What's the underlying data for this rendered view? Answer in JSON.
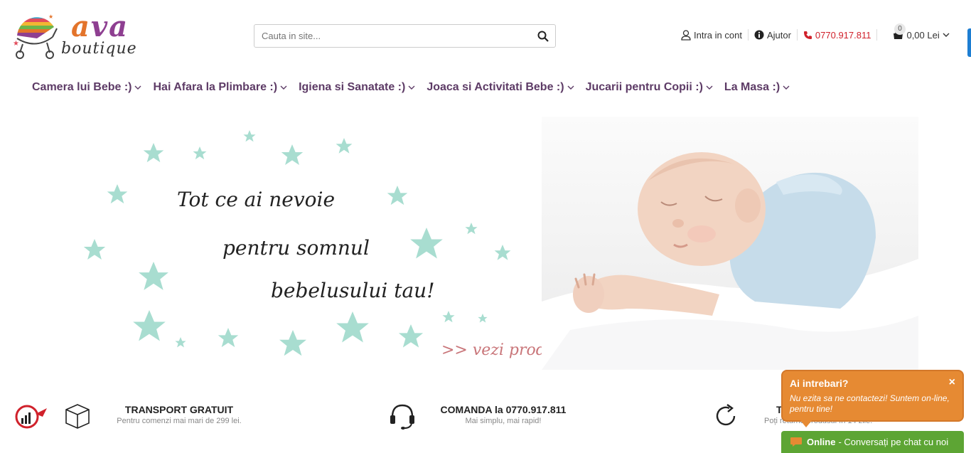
{
  "logo": {
    "ava_a1": "a",
    "ava_v": "v",
    "ava_a2": "a",
    "boutique": "boutique"
  },
  "search": {
    "placeholder": "Cauta in site..."
  },
  "toplinks": {
    "account": "Intra in cont",
    "help": "Ajutor",
    "phone": "0770.917.811",
    "cart_count": "0",
    "cart_total": "0,00 Lei"
  },
  "nav": {
    "items": [
      {
        "label": "Camera lui Bebe :)"
      },
      {
        "label": "Hai Afara la Plimbare :)"
      },
      {
        "label": "Igiena si Sanatate :)"
      },
      {
        "label": "Joaca si Activitati Bebe :)"
      },
      {
        "label": "Jucarii pentru Copii :)"
      },
      {
        "label": "La Masa :)"
      }
    ]
  },
  "banner": {
    "line1": "Tot ce ai nevoie",
    "line2": "pentru somnul",
    "line3": "bebelusului tau!",
    "cta": ">> vezi produse"
  },
  "features": {
    "transport_title": "TRANSPORT GRATUIT",
    "transport_sub": "Pentru comenzi mai mari de 299 lei.",
    "order_title": "COMANDA la 0770.917.811",
    "order_sub": "Mai simplu, mai rapid!",
    "return_title": "T",
    "return_sub": "Poți returna produsul în 14 zile."
  },
  "chat": {
    "title": "Ai intrebari?",
    "close": "×",
    "message": "Nu ezita sa ne contactezi! Suntem on-line, pentru tine!",
    "bar_online": "Online",
    "bar_text": "- Conversați pe chat cu noi"
  },
  "colors": {
    "brand_purple": "#5d3b66",
    "phone_red": "#d0212b",
    "chat_orange": "#e68a33",
    "chat_green": "#5da534",
    "star_mint": "#a8ddd0"
  }
}
